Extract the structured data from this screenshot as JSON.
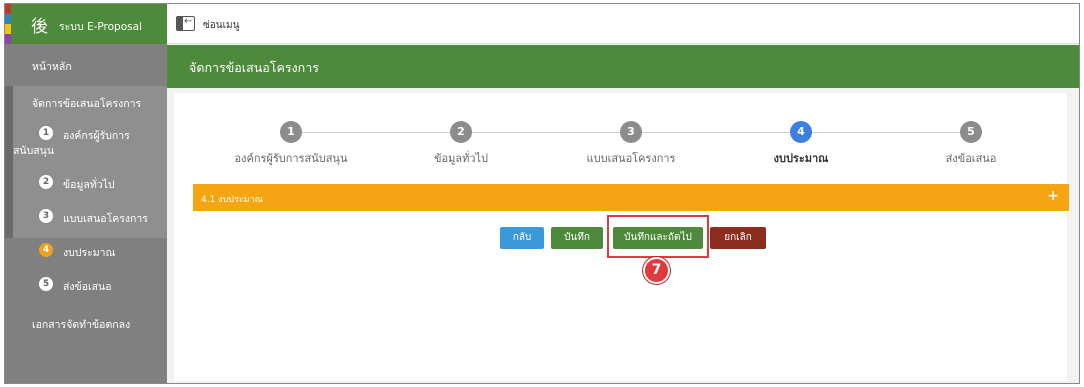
{
  "app": {
    "logo_glyph": "後",
    "name": "ระบบ E-Proposal"
  },
  "topbar": {
    "toggle_label": "ซ่อนเมนู"
  },
  "sidebar": {
    "items": [
      {
        "label": "หน้าหลัก"
      },
      {
        "label": "จัดการข้อเสนอโครงการ"
      },
      {
        "num": "1",
        "label_line1": "องค์กรผู้รับการ",
        "label_line2": "สนับสนุน"
      },
      {
        "num": "2",
        "label": "ข้อมูลทั่วไป"
      },
      {
        "num": "3",
        "label": "แบบเสนอโครงการ"
      },
      {
        "num": "4",
        "label": "งบประมาณ"
      },
      {
        "num": "5",
        "label": "ส่งข้อเสนอ"
      },
      {
        "label": "เอกสารจัดทำข้อตกลง"
      }
    ]
  },
  "page": {
    "title": "จัดการข้อเสนอโครงการ"
  },
  "steps": [
    {
      "num": "1",
      "label": "องค์กรผู้รับการสนับสนุน"
    },
    {
      "num": "2",
      "label": "ข้อมูลทั่วไป"
    },
    {
      "num": "3",
      "label": "แบบเสนอโครงการ"
    },
    {
      "num": "4",
      "label": "งบประมาณ"
    },
    {
      "num": "5",
      "label": "ส่งข้อเสนอ"
    }
  ],
  "section": {
    "title": "4.1 งบประมาณ",
    "expand_glyph": "+"
  },
  "buttons": {
    "back": "กลับ",
    "save": "บันทึก",
    "save_next": "บันทึกและถัดไป",
    "cancel": "ยกเลิก"
  },
  "annotation": {
    "marker": "7"
  },
  "colors": {
    "brand_green": "#4e8a3b",
    "sidebar_gray": "#808080",
    "accordion_orange": "#f5a511",
    "step_current_blue": "#3d7fe0",
    "highlight_red": "#e0393e"
  }
}
